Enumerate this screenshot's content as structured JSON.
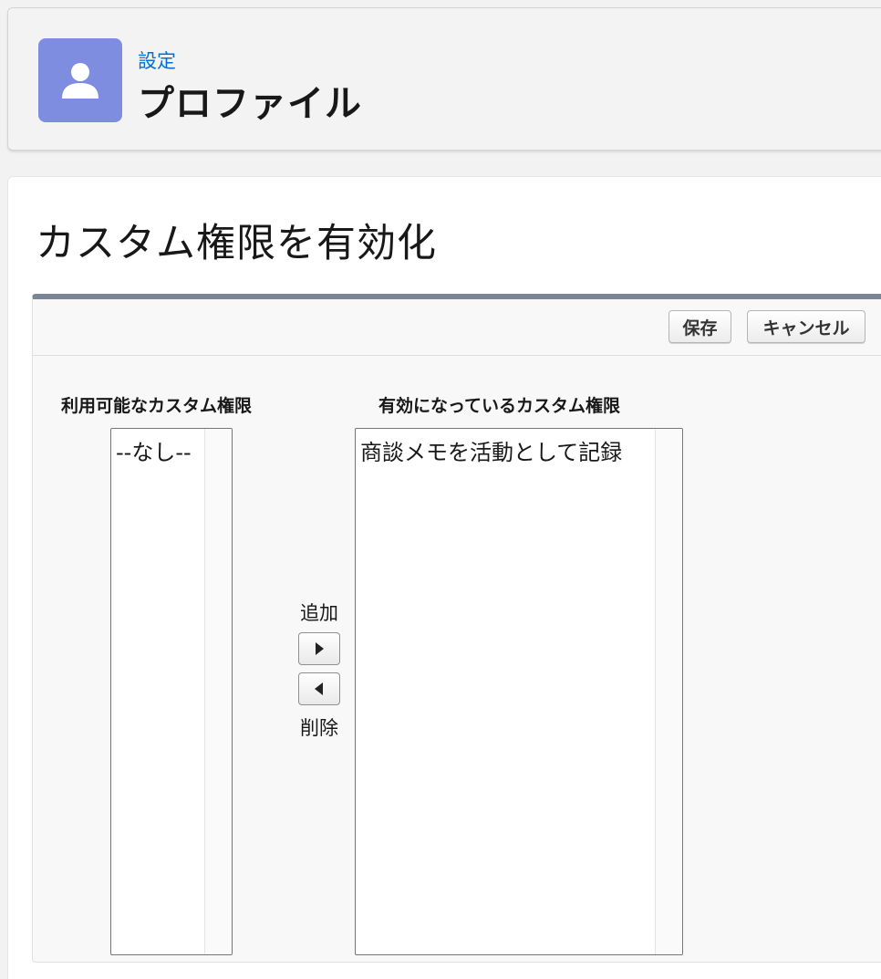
{
  "header": {
    "breadcrumb": "設定",
    "title": "プロファイル",
    "avatar_icon": "user-icon",
    "avatar_color": "#7f8de1"
  },
  "main": {
    "section_title": "カスタム権限を有効化",
    "buttons": {
      "save": "保存",
      "cancel": "キャンセル"
    },
    "available": {
      "label": "利用可能なカスタム権限",
      "options": [
        "--なし--"
      ]
    },
    "enabled": {
      "label": "有効になっているカスタム権限",
      "options": [
        "商談メモを活動として記録"
      ]
    },
    "add_label": "追加",
    "remove_label": "削除"
  },
  "colors": {
    "link": "#0b6fc7",
    "block_top_border": "#7c8597"
  }
}
